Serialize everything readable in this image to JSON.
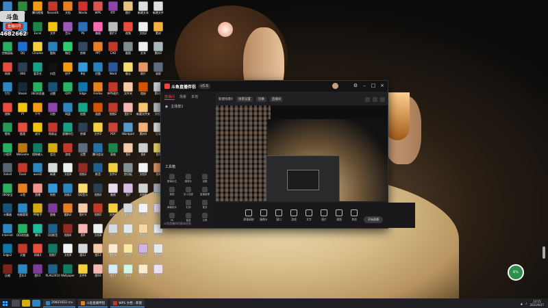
{
  "overlay": {
    "logo": "斗鱼",
    "live": "直播间号",
    "room_id": "4682662"
  },
  "desktop_icons": [
    {
      "label": "我的电脑",
      "color": "#3d84c6"
    },
    {
      "label": "360",
      "color": "#2e8b3d"
    },
    {
      "label": "腾讯视频",
      "color": "#f39c12"
    },
    {
      "label": "Recordit",
      "color": "#c0392b"
    },
    {
      "label": "文档",
      "color": "#e67e22"
    },
    {
      "label": "Wordo",
      "color": "#d32f2f"
    },
    {
      "label": "WPS",
      "color": "#d9534f"
    },
    {
      "label": "RTF",
      "color": "#8e44ad"
    },
    {
      "label": "图片",
      "color": "#e8c27a"
    },
    {
      "label": "新建文本",
      "color": "#dddddd"
    },
    {
      "label": "新建文件",
      "color": "#e0e0e0"
    },
    {
      "label": "回收站",
      "color": "#6aa1d8"
    },
    {
      "label": "百度网盘",
      "color": "#3498db"
    },
    {
      "label": "Excel",
      "color": "#1e8449"
    },
    {
      "label": "文件",
      "color": "#f1c40f"
    },
    {
      "label": "音乐",
      "color": "#9b59b6"
    },
    {
      "label": "PS",
      "color": "#2c6fb7"
    },
    {
      "label": "美图",
      "color": "#ff69b4"
    },
    {
      "label": "图片2",
      "color": "#bbbbbb"
    },
    {
      "label": "视频",
      "color": "#e74c3c"
    },
    {
      "label": "文档2",
      "color": "#ecf0f1"
    },
    {
      "label": "素材",
      "color": "#f5b041"
    },
    {
      "label": "控制面板",
      "color": "#27ae60"
    },
    {
      "label": "QQ",
      "color": "#1f6fd1"
    },
    {
      "label": "Chrome",
      "color": "#f4d03f"
    },
    {
      "label": "酷狗",
      "color": "#2980b9"
    },
    {
      "label": "微信",
      "color": "#2ecc71"
    },
    {
      "label": "剪映",
      "color": "#34495e"
    },
    {
      "label": "PPT",
      "color": "#e67e22"
    },
    {
      "label": "CAD",
      "color": "#c0392b"
    },
    {
      "label": "截图",
      "color": "#7f8c8d"
    },
    {
      "label": "文本",
      "color": "#ecf0f1"
    },
    {
      "label": "素材2",
      "color": "#aab7b8"
    },
    {
      "label": "网易",
      "color": "#e74c3c"
    },
    {
      "label": "OBS",
      "color": "#2c3e50"
    },
    {
      "label": "爱奇艺",
      "color": "#16a085"
    },
    {
      "label": "抖音",
      "color": "#111111"
    },
    {
      "label": "快手",
      "color": "#f39c12"
    },
    {
      "label": "B站",
      "color": "#3498db"
    },
    {
      "label": "优酷",
      "color": "#2980b9"
    },
    {
      "label": "Word",
      "color": "#2b579a"
    },
    {
      "label": "备忘",
      "color": "#f7dc6f"
    },
    {
      "label": "照片",
      "color": "#e59866"
    },
    {
      "label": "录屏",
      "color": "#5d6d7e"
    },
    {
      "label": "钉钉",
      "color": "#2e86c1"
    },
    {
      "label": "Steam",
      "color": "#1b2838"
    },
    {
      "label": "360浏览器",
      "color": "#27ae60"
    },
    {
      "label": "迅雷",
      "color": "#1a5276"
    },
    {
      "label": "iQIYI",
      "color": "#28b463"
    },
    {
      "label": "Edge",
      "color": "#0e76a8"
    },
    {
      "label": "Firefox",
      "color": "#e67e22"
    },
    {
      "label": "WPS图片",
      "color": "#c0392b"
    },
    {
      "label": "文件夹",
      "color": "#f5cba7"
    },
    {
      "label": "相册",
      "color": "#d35400"
    },
    {
      "label": "素材3",
      "color": "#d5d8dc"
    },
    {
      "label": "搜狗",
      "color": "#e74c3c"
    },
    {
      "label": "YY",
      "color": "#f1c40f"
    },
    {
      "label": "千牛",
      "color": "#f39c12"
    },
    {
      "label": "闪剪",
      "color": "#8e44ad"
    },
    {
      "label": "网盘",
      "color": "#2e86c1"
    },
    {
      "label": "绘图",
      "color": "#17a589"
    },
    {
      "label": "画图",
      "color": "#d35400"
    },
    {
      "label": "视频2",
      "color": "#c0392b"
    },
    {
      "label": "图片3",
      "color": "#f5b7b1"
    },
    {
      "label": "新建文件夹",
      "color": "#f8c471"
    },
    {
      "label": "文档3",
      "color": "#bdc3c7"
    },
    {
      "label": "壁纸",
      "color": "#229954"
    },
    {
      "label": "酷我",
      "color": "#e74c3c"
    },
    {
      "label": "虎牙",
      "color": "#f1c40f"
    },
    {
      "label": "网易云",
      "color": "#c0392b"
    },
    {
      "label": "直播伴侣",
      "color": "#16a085"
    },
    {
      "label": "剪辑",
      "color": "#2e4053"
    },
    {
      "label": "文件2",
      "color": "#f4d03f"
    },
    {
      "label": "PDF",
      "color": "#cb4335"
    },
    {
      "label": "Wordpad",
      "color": "#5499c7"
    },
    {
      "label": "素材4",
      "color": "#f0b27a"
    },
    {
      "label": "记录",
      "color": "#e5e8e8"
    },
    {
      "label": "小程序",
      "color": "#27ae60"
    },
    {
      "label": "WeGame",
      "color": "#b9770e"
    },
    {
      "label": "搜狗输入",
      "color": "#117a65"
    },
    {
      "label": "会员",
      "color": "#d4ac0d"
    },
    {
      "label": "游戏",
      "color": "#c0392b"
    },
    {
      "label": "设置",
      "color": "#5d6d7e"
    },
    {
      "label": "腾讯会议",
      "color": "#2471a3"
    },
    {
      "label": "表格",
      "color": "#1e8449"
    },
    {
      "label": "图3",
      "color": "#f5cba7"
    },
    {
      "label": "图4",
      "color": "#cacfd2"
    },
    {
      "label": "图5",
      "color": "#f7dc6f"
    },
    {
      "label": "Xshell",
      "color": "#566573"
    },
    {
      "label": "Flash",
      "color": "#c0392b"
    },
    {
      "label": "word2",
      "color": "#2e86c1"
    },
    {
      "label": "新建",
      "color": "#d5dbdb"
    },
    {
      "label": "文档4",
      "color": "#ecf0f1"
    },
    {
      "label": "视频3",
      "color": "#922b21"
    },
    {
      "label": "影音",
      "color": "#1f618d"
    },
    {
      "label": "文件3",
      "color": "#f4d03f"
    },
    {
      "label": "剪切板",
      "color": "#839192"
    },
    {
      "label": "文档5",
      "color": "#f2f3f4"
    },
    {
      "label": "图6",
      "color": "#e59866"
    },
    {
      "label": "360安全",
      "color": "#27ae60"
    },
    {
      "label": "斗鱼",
      "color": "#e67e22"
    },
    {
      "label": "直播",
      "color": "#f1948a"
    },
    {
      "label": "快剪",
      "color": "#3498db"
    },
    {
      "label": "网易2",
      "color": "#2e86c1"
    },
    {
      "label": "QQ音乐",
      "color": "#f7dc6f"
    },
    {
      "label": "视频4",
      "color": "#2c3e50"
    },
    {
      "label": "美颜",
      "color": "#e8daef"
    },
    {
      "label": "图7",
      "color": "#d7bde2"
    },
    {
      "label": "文档6",
      "color": "#d0d3d4"
    },
    {
      "label": "素材5",
      "color": "#aeb6bf"
    },
    {
      "label": "计算器",
      "color": "#1a5276"
    },
    {
      "label": "电脑管家",
      "color": "#2e86c1"
    },
    {
      "label": "PP助手",
      "color": "#d4ac0d"
    },
    {
      "label": "图像",
      "color": "#7d3c98"
    },
    {
      "label": "酷狗2",
      "color": "#e67e22"
    },
    {
      "label": "图片4",
      "color": "#f5cba7"
    },
    {
      "label": "视频5",
      "color": "#c0392b"
    },
    {
      "label": "文件4",
      "color": "#f4d03f"
    },
    {
      "label": "素材6",
      "color": "#d5d8dc"
    },
    {
      "label": "文档7",
      "color": "#f2f3f4"
    },
    {
      "label": "图8",
      "color": "#e8daef"
    },
    {
      "label": "Internet",
      "color": "#2e86c1"
    },
    {
      "label": "QQ浏览器",
      "color": "#27ae60"
    },
    {
      "label": "腾讯",
      "color": "#1abc9c"
    },
    {
      "label": "QQ影音",
      "color": "#1f618d"
    },
    {
      "label": "视频6",
      "color": "#922b21"
    },
    {
      "label": "图9",
      "color": "#f5b7b1"
    },
    {
      "label": "文档8",
      "color": "#ecf0f1"
    },
    {
      "label": "图10",
      "color": "#d6dbdf"
    },
    {
      "label": "图11",
      "color": "#e5e7e9"
    },
    {
      "label": "素材7",
      "color": "#fad7a0"
    },
    {
      "label": "记事本",
      "color": "#f2f3f4"
    },
    {
      "label": "Edge2",
      "color": "#0e76a8"
    },
    {
      "label": "天猫",
      "color": "#c0392b"
    },
    {
      "label": "网易3",
      "color": "#e74c3c"
    },
    {
      "label": "视频7",
      "color": "#117864"
    },
    {
      "label": "文档9",
      "color": "#f2f3f4"
    },
    {
      "label": "图12",
      "color": "#d5d8dc"
    },
    {
      "label": "图13",
      "color": "#f5cba7"
    },
    {
      "label": "素材8",
      "color": "#fdebd0"
    },
    {
      "label": "文件5",
      "color": "#f9e79f"
    },
    {
      "label": "图14",
      "color": "#d2b4de"
    },
    {
      "label": "素材9",
      "color": "#e5e8e8"
    },
    {
      "label": "压缩",
      "color": "#7b241c"
    },
    {
      "label": "音乐2",
      "color": "#2e86c1"
    },
    {
      "label": "图15",
      "color": "#7d3c98"
    },
    {
      "label": "RLAG2010",
      "color": "#1f618d"
    },
    {
      "label": "Wallpaper",
      "color": "#117a65"
    },
    {
      "label": "文件6",
      "color": "#f4d03f"
    },
    {
      "label": "图16",
      "color": "#f5b7b1"
    },
    {
      "label": "图17",
      "color": "#d6eaf8"
    },
    {
      "label": "图18",
      "color": "#d5f5e3"
    },
    {
      "label": "图19",
      "color": "#fdebd0"
    },
    {
      "label": "图20",
      "color": "#ebdef0"
    }
  ],
  "app": {
    "name": "斗鱼直播伴侣",
    "version": "v5.6",
    "side_tabs": [
      "直播间",
      "场景",
      "本地"
    ],
    "scene_label": "主场景1",
    "tools_title": "工具箱",
    "tools": [
      "屏幕标注",
      "摄像头",
      "设置",
      "美颜",
      "多人连麦",
      "直播管理",
      "弹幕助手",
      "礼物",
      "更多",
      "PK",
      "抽奖",
      "分享"
    ],
    "footer": "斗鱼直播伴侣版本信息",
    "top_title": "新建场景0",
    "top_chips": [
      "场景设置",
      "切换",
      "直播间"
    ],
    "bottom_buttons": [
      "屏幕录制",
      "摄像头",
      "窗口",
      "游戏",
      "文字",
      "图片",
      "视频",
      "其他"
    ],
    "start_live": "开始直播"
  },
  "taskbar": {
    "tasks": [
      {
        "label": "20821022.rcv",
        "color": "#2e86c1"
      },
      {
        "label": "斗鱼直播伴侣",
        "color": "#e67e22"
      },
      {
        "label": "WPS 文档 - 新建",
        "color": "#c0392b"
      }
    ],
    "tray_time": "13:15",
    "tray_date": "2021/9/27"
  },
  "float_ball": "6%"
}
